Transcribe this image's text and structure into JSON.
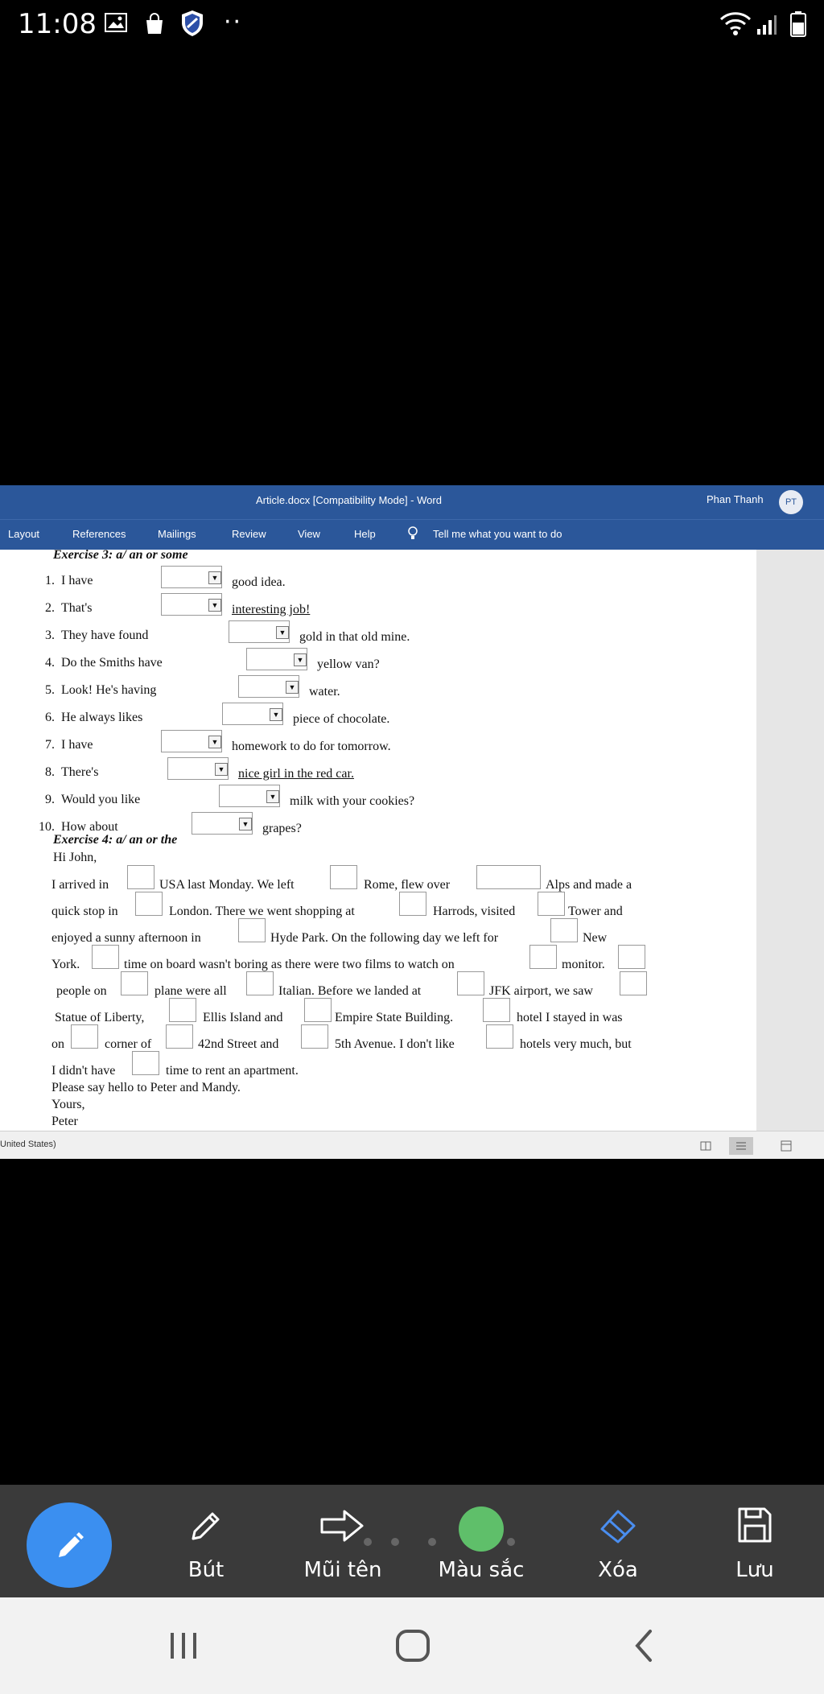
{
  "status_bar": {
    "time": "11:08"
  },
  "word": {
    "title": "Article.docx [Compatibility Mode]  -  Word",
    "user": "Phan Thanh",
    "avatar_initials": "PT",
    "ribbon_tabs": [
      "Layout",
      "References",
      "Mailings",
      "Review",
      "View",
      "Help"
    ],
    "tell_me": "Tell me what you want to do",
    "status_lang": "United States)"
  },
  "exercise3": {
    "heading": "Exercise 3: a/ an or some",
    "items": [
      {
        "num": "1.",
        "stem": "I have",
        "after": "good idea."
      },
      {
        "num": "2.",
        "stem": "That's",
        "after": "interesting job!"
      },
      {
        "num": "3.",
        "stem": "They have found",
        "after": "gold in that old mine."
      },
      {
        "num": "4.",
        "stem": "Do the Smiths have",
        "after": "yellow van?"
      },
      {
        "num": "5.",
        "stem": "Look! He's having",
        "after": "water."
      },
      {
        "num": "6.",
        "stem": "He always likes",
        "after": "piece of chocolate."
      },
      {
        "num": "7.",
        "stem": "I have",
        "after": "homework to do for tomorrow."
      },
      {
        "num": "8.",
        "stem": "There's",
        "after": "nice girl in the red car."
      },
      {
        "num": "9.",
        "stem": "Would you like",
        "after": "milk with your cookies?"
      },
      {
        "num": "10.",
        "stem": "How about",
        "after": "grapes?"
      }
    ]
  },
  "exercise4": {
    "heading": "Exercise 4: a/ an or the",
    "greeting": "Hi John,",
    "lines": [
      [
        "I arrived in",
        "USA last Monday. We left",
        "Rome, flew over",
        "Alps and made a"
      ],
      [
        "quick stop in",
        "London. There we went shopping at",
        "Harrods, visited",
        "Tower and"
      ],
      [
        "enjoyed a sunny afternoon in",
        "Hyde Park. On the following day we left for",
        "New"
      ],
      [
        "York.",
        "time on board wasn't boring as there were two films to watch on",
        "monitor."
      ],
      [
        "people on",
        "plane were all",
        "Italian. Before we landed at",
        "JFK airport, we saw"
      ],
      [
        "Statue of Liberty,",
        "Ellis Island and",
        "Empire State Building.",
        "hotel I stayed in was"
      ],
      [
        "on",
        "corner of",
        "42nd Street and",
        "5th Avenue. I don't like",
        "hotels very much, but"
      ],
      [
        "I didn't have",
        "time to rent an apartment."
      ]
    ],
    "closing1": "Please say hello to Peter and Mandy.",
    "closing2": "Yours,",
    "signature": "Peter"
  },
  "toolbar": {
    "pen": "Bút",
    "arrow": "Mũi tên",
    "color": "Màu sắc",
    "erase": "Xóa",
    "save": "Lưu",
    "selected_color": "#5fbf6a"
  },
  "colors": {
    "word_blue": "#2b579a",
    "fab_blue": "#3b8ff0",
    "toolbar_bg": "#3a3a3a"
  }
}
